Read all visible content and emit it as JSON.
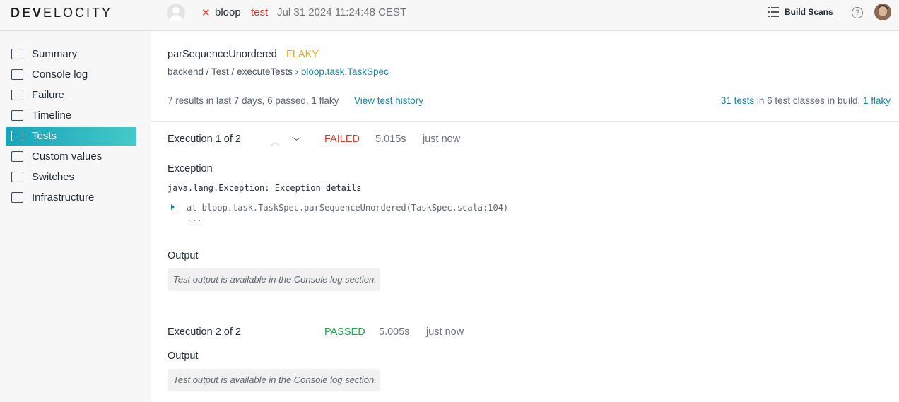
{
  "header": {
    "logo": {
      "bold": "DEV",
      "rest": "ELOCITY"
    },
    "status_glyph": "✕",
    "project": "bloop",
    "task": "test",
    "build_time": "Jul 31 2024 11:24:48 CEST",
    "build_scans_label": "Build Scans",
    "help_glyph": "?"
  },
  "sidebar": {
    "items": [
      {
        "label": "Summary",
        "icon": "summary-icon",
        "active": false
      },
      {
        "label": "Console log",
        "icon": "console-icon",
        "active": false
      },
      {
        "label": "Failure",
        "icon": "failure-icon",
        "active": false
      },
      {
        "label": "Timeline",
        "icon": "timeline-icon",
        "active": false
      },
      {
        "label": "Tests",
        "icon": "tests-icon",
        "active": true
      },
      {
        "label": "Custom values",
        "icon": "custom-values-icon",
        "active": false
      },
      {
        "label": "Switches",
        "icon": "switches-icon",
        "active": false
      },
      {
        "label": "Infrastructure",
        "icon": "infrastructure-icon",
        "active": false
      }
    ]
  },
  "test": {
    "name": "parSequenceUnordered",
    "tag": "FLAKY",
    "breadcrumb_path": "backend / Test / executeTests",
    "breadcrumb_sep": "›",
    "breadcrumb_class": "bloop.task.TaskSpec",
    "summary": "7 results in last 7 days, 6 passed, 1 flaky",
    "history_link": "View test history",
    "totals": {
      "tests_link": "31 tests",
      "text": " in 6 test classes in build, ",
      "flaky_link": "1 flaky"
    }
  },
  "executions": [
    {
      "title": "Execution 1 of 2",
      "status": "FAILED",
      "duration": "5.015s",
      "when": "just now",
      "exception_label": "Exception",
      "exception": "java.lang.Exception: Exception details",
      "stack_line": "at bloop.task.TaskSpec.parSequenceUnordered(TaskSpec.scala:104)",
      "stack_more": "...",
      "output_label": "Output",
      "output_note": "Test output is available in the Console log section."
    },
    {
      "title": "Execution 2 of 2",
      "status": "PASSED",
      "duration": "5.005s",
      "when": "just now",
      "output_label": "Output",
      "output_note": "Test output is available in the Console log section."
    }
  ],
  "colors": {
    "accent": "#1286a3",
    "failed": "#d93a2b",
    "passed": "#1ea548",
    "flaky": "#e0a81e"
  }
}
